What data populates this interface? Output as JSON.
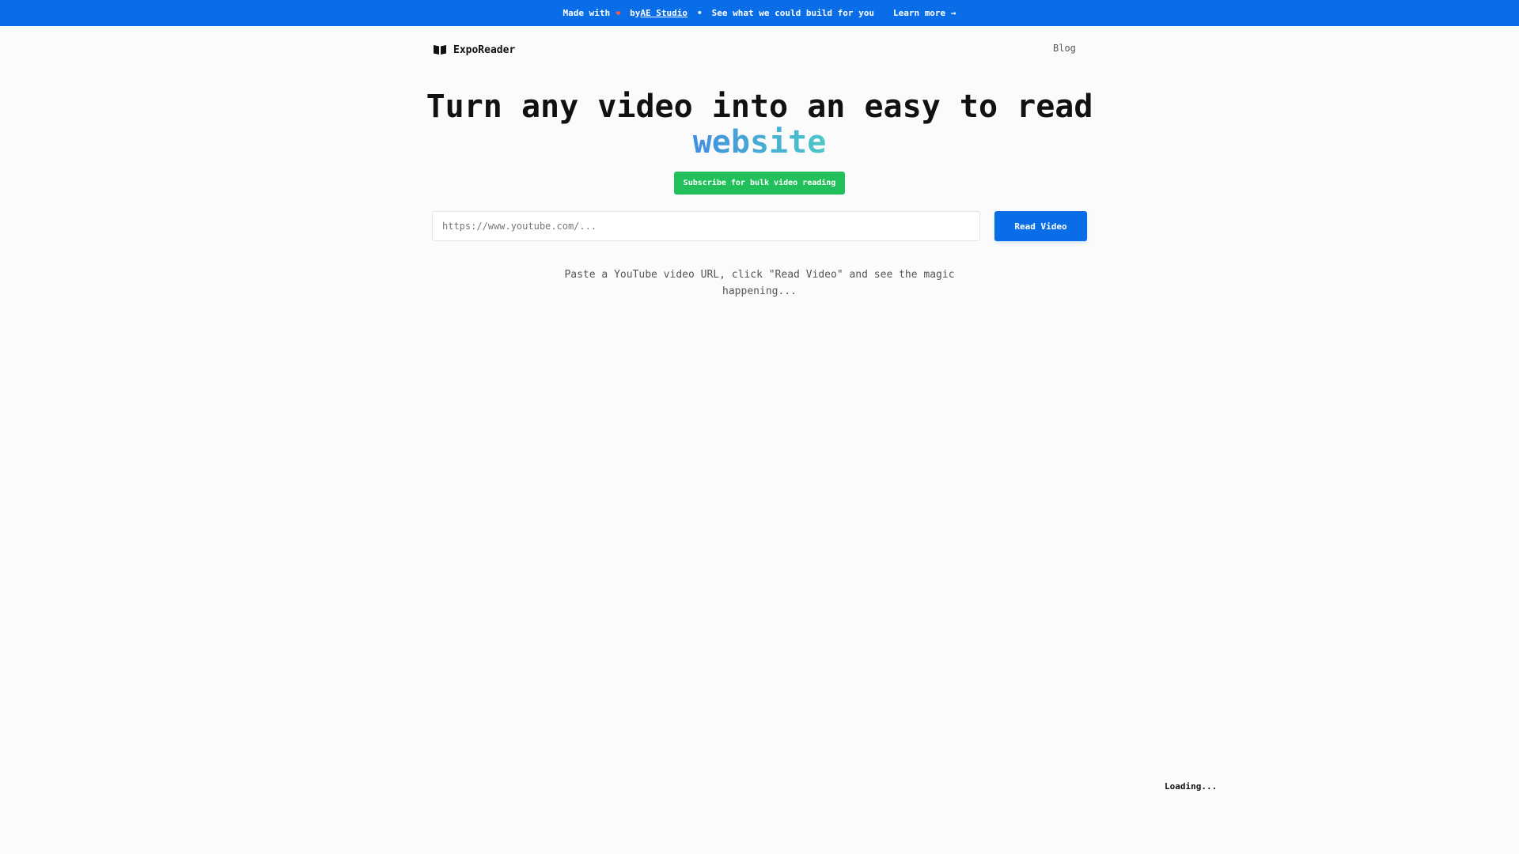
{
  "banner": {
    "made_with": "Made with",
    "heart": "❤",
    "by": "by",
    "studio_link": "AE Studio",
    "separator": "•",
    "tagline": "See what we could build for you",
    "learn_more": "Learn more →"
  },
  "header": {
    "brand": "ExpoReader",
    "blog_link": "Blog"
  },
  "hero": {
    "title": "Turn any video into an easy to read",
    "accent": "website",
    "subscribe_button": "Subscribe for bulk video reading"
  },
  "form": {
    "url_placeholder": "https://www.youtube.com/...",
    "url_value": "",
    "read_button": "Read Video"
  },
  "hint": "Paste a YouTube video URL, click \"Read Video\" and see the magic happening...",
  "status": {
    "loading": "Loading..."
  },
  "icons": {
    "brand_icon": "open-book-icon",
    "heart_icon": "heart-icon"
  },
  "colors": {
    "banner": "#0a6de8",
    "primary": "#0a6de8",
    "subscribe": "#22c05a",
    "heart": "#ff5a4a",
    "gradient_start": "#3f8fe0",
    "gradient_end": "#4dc7c8"
  }
}
